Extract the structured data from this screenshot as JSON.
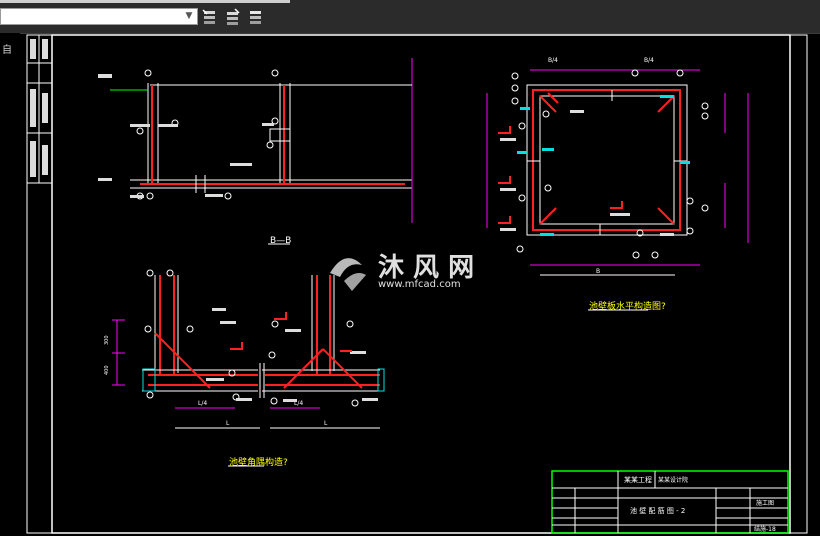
{
  "toolbar": {
    "combo_value": "",
    "buttons": [
      "layer-state-icon",
      "layer-match-icon",
      "layer-previous-icon"
    ]
  },
  "left_strip": {
    "glyph": "自"
  },
  "drawing": {
    "section_label": "B—B",
    "plan_caption": "池壁板水平构造图?",
    "corner_caption": "池壁角隅构造?",
    "dimensions": {
      "B": "B",
      "L4": "L/4",
      "L": "L",
      "B4": "B/4",
      "H300": "300",
      "H400": "400"
    },
    "title_block": {
      "project": "某某工程",
      "design_unit": "某某设计院",
      "drawing_title": "池 壁 配 筋 图 - 2",
      "stage": "施工图",
      "sheet": "结施-18"
    },
    "watermark_main": "沐 风 网",
    "watermark_url": "www.mfcad.com",
    "colors": {
      "rebar": "#ff2020",
      "outline": "#ffffff",
      "dims": "#ff00ff",
      "cyan": "#00e0e0",
      "green": "#00ff00",
      "yellow": "#ffff00"
    }
  }
}
